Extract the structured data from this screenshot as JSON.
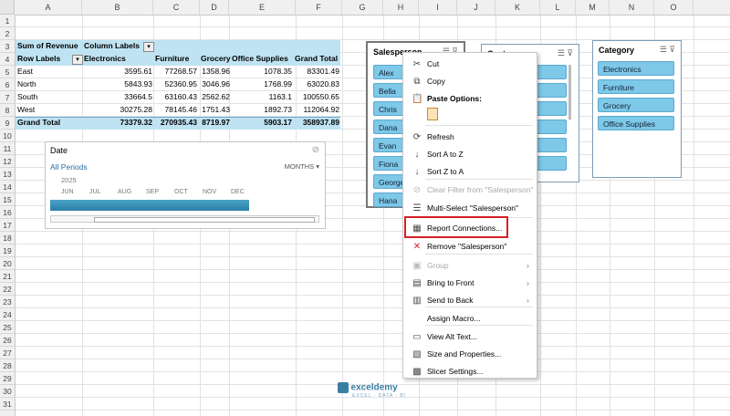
{
  "columns": [
    "A",
    "B",
    "C",
    "D",
    "E",
    "F",
    "G",
    "H",
    "I",
    "J",
    "K",
    "L",
    "M",
    "N",
    "O"
  ],
  "rows": [
    "1",
    "2",
    "3",
    "4",
    "5",
    "6",
    "7",
    "8",
    "9",
    "10",
    "11",
    "12",
    "13",
    "14",
    "15",
    "16",
    "17",
    "18",
    "19",
    "20",
    "21",
    "22",
    "23",
    "24",
    "25",
    "26",
    "27",
    "28",
    "29",
    "30",
    "31"
  ],
  "pivot": {
    "corner_label": "Sum of Revenue",
    "column_labels": "Column Labels",
    "row_labels": "Row Labels",
    "headers": [
      "Electronics",
      "Furniture",
      "Grocery",
      "Office Supplies",
      "Grand Total"
    ],
    "data_rows": [
      {
        "label": "East",
        "values": [
          "3595.61",
          "77268.57",
          "1358.96",
          "1078.35",
          "83301.49"
        ]
      },
      {
        "label": "North",
        "values": [
          "5843.93",
          "52360.95",
          "3046.96",
          "1768.99",
          "63020.83"
        ]
      },
      {
        "label": "South",
        "values": [
          "33664.5",
          "63160.43",
          "2562.62",
          "1163.1",
          "100550.65"
        ]
      },
      {
        "label": "West",
        "values": [
          "30275.28",
          "78145.46",
          "1751.43",
          "1892.73",
          "112064.92"
        ]
      }
    ],
    "total": {
      "label": "Grand Total",
      "values": [
        "73379.32",
        "270935.43",
        "8719.97",
        "5903.17",
        "358937.89"
      ]
    }
  },
  "timeline": {
    "title": "Date",
    "period_label": "All Periods",
    "level": "MONTHS",
    "year": "2025",
    "months": [
      "JUN",
      "JUL",
      "AUG",
      "SEP",
      "OCT",
      "NOV",
      "DEC"
    ]
  },
  "slicer_salesperson": {
    "title": "Salesperson",
    "items": [
      "Alex",
      "Bella",
      "Chris",
      "Dana",
      "Evan",
      "Fiona",
      "George",
      "Hana"
    ]
  },
  "slicer_customer": {
    "title": "Customer"
  },
  "slicer_category": {
    "title": "Category",
    "items": [
      "Electronics",
      "Furniture",
      "Grocery",
      "Office Supplies"
    ]
  },
  "context_menu": {
    "items": [
      {
        "icon": "scissors-icon",
        "glyph": "✂",
        "label": "Cut",
        "disabled": false
      },
      {
        "icon": "copy-icon",
        "glyph": "⧉",
        "label": "Copy",
        "disabled": false
      },
      {
        "icon": "paste-icon",
        "glyph": "📋",
        "label": "Paste Options:",
        "disabled": false,
        "bold": true
      },
      {
        "icon": "refresh-icon",
        "glyph": "⟳",
        "label": "Refresh",
        "disabled": false
      },
      {
        "icon": "sort-asc-icon",
        "glyph": "↓",
        "label": "Sort A to Z",
        "disabled": false
      },
      {
        "icon": "sort-desc-icon",
        "glyph": "↓",
        "label": "Sort Z to A",
        "disabled": false
      },
      {
        "icon": "clear-filter-icon",
        "glyph": "⊘",
        "label": "Clear Filter from \"Salesperson\"",
        "disabled": true
      },
      {
        "icon": "multiselect-icon",
        "glyph": "☰",
        "label": "Multi-Select \"Salesperson\"",
        "disabled": false
      },
      {
        "icon": "report-connections-icon",
        "glyph": "▦",
        "label": "Report Connections...",
        "disabled": false
      },
      {
        "icon": "remove-icon",
        "glyph": "✕",
        "label": "Remove \"Salesperson\"",
        "disabled": false
      },
      {
        "icon": "group-icon",
        "glyph": "▣",
        "label": "Group",
        "disabled": true,
        "submenu": true
      },
      {
        "icon": "bring-front-icon",
        "glyph": "▤",
        "label": "Bring to Front",
        "disabled": false,
        "submenu": true
      },
      {
        "icon": "send-back-icon",
        "glyph": "▥",
        "label": "Send to Back",
        "disabled": false,
        "submenu": true
      },
      {
        "icon": "macro-icon",
        "glyph": "",
        "label": "Assign Macro...",
        "disabled": false
      },
      {
        "icon": "alt-text-icon",
        "glyph": "▭",
        "label": "View Alt Text...",
        "disabled": false
      },
      {
        "icon": "size-properties-icon",
        "glyph": "▧",
        "label": "Size and Properties...",
        "disabled": false
      },
      {
        "icon": "slicer-settings-icon",
        "glyph": "▩",
        "label": "Slicer Settings...",
        "disabled": false
      }
    ]
  },
  "watermark": {
    "brand": "exceldemy",
    "tagline": "EXCEL · DATA · BI"
  },
  "colors": {
    "accent": "#7ec8e8",
    "highlight_border": "#d42027",
    "pivot_header": "#bfe3f2"
  }
}
